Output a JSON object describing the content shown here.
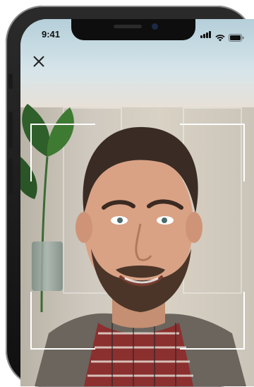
{
  "status_bar": {
    "time": "9:41",
    "icons": [
      "cellular-signal-icon",
      "wifi-icon",
      "battery-icon"
    ]
  },
  "toolbar": {
    "close_icon": "close-icon"
  },
  "colors": {
    "frame": "#ffffff",
    "status_text": "#111111"
  }
}
